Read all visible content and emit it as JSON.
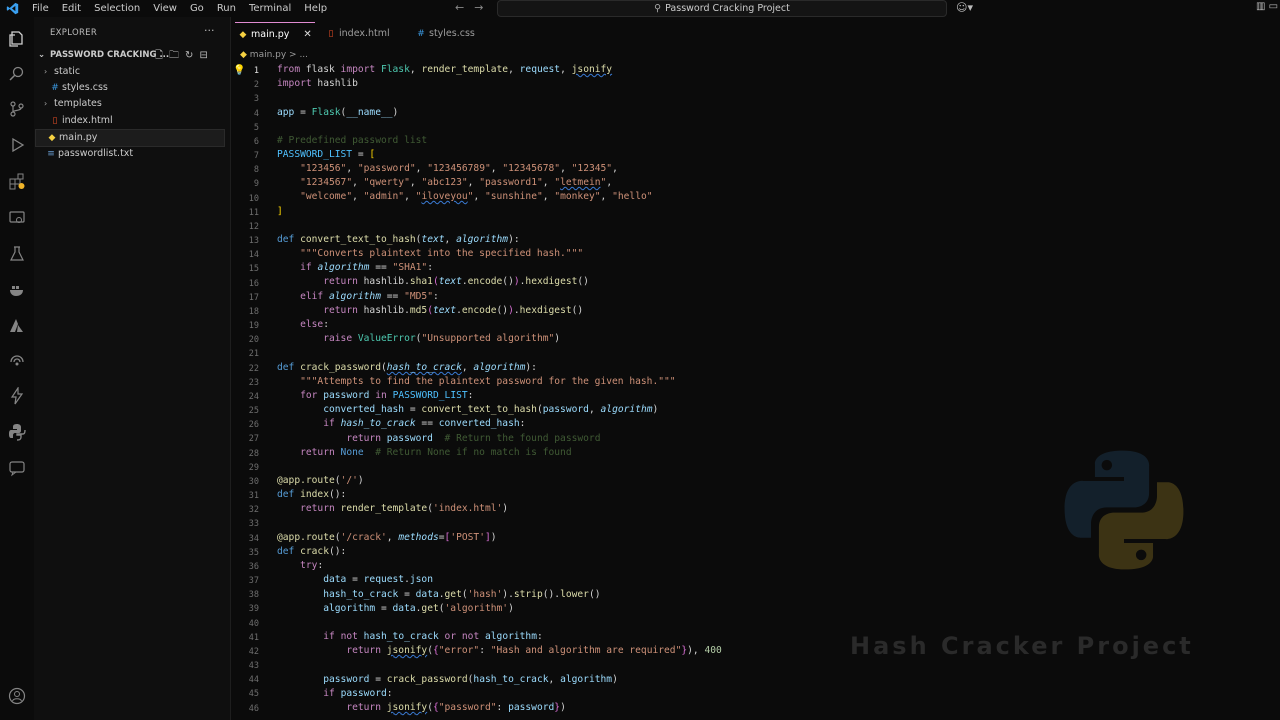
{
  "menu": [
    "File",
    "Edit",
    "Selection",
    "View",
    "Go",
    "Run",
    "Terminal",
    "Help"
  ],
  "search": {
    "text": "Password Cracking Project"
  },
  "sidebar": {
    "title": "EXPLORER",
    "folder": "PASSWORD CRACKING ...",
    "items": [
      {
        "label": "static",
        "kind": "folder"
      },
      {
        "label": "styles.css",
        "kind": "css"
      },
      {
        "label": "templates",
        "kind": "folder"
      },
      {
        "label": "index.html",
        "kind": "html"
      },
      {
        "label": "main.py",
        "kind": "python",
        "selected": true
      },
      {
        "label": "passwordlist.txt",
        "kind": "text"
      }
    ]
  },
  "tabs": [
    {
      "label": "main.py",
      "active": true
    },
    {
      "label": "index.html"
    },
    {
      "label": "styles.css"
    }
  ],
  "breadcrumb": "main.py > ...",
  "editor": {
    "line_numbers": [
      "1",
      "2",
      "3",
      "4",
      "5",
      "6",
      "7",
      "8",
      "9",
      "10",
      "11",
      "12",
      "13",
      "14",
      "15",
      "16",
      "17",
      "18",
      "19",
      "20",
      "21",
      "22",
      "23",
      "24",
      "25",
      "26",
      "27",
      "28",
      "29",
      "30",
      "31",
      "32",
      "33",
      "34",
      "35",
      "36",
      "37",
      "38",
      "39",
      "40",
      "41",
      "42",
      "43",
      "44",
      "45",
      "46"
    ],
    "current_line": 1
  },
  "watermark": {
    "text": "Hash Cracker Project"
  },
  "colors": {
    "accent_tab": "#e08bd2",
    "keyword": "#c586c0",
    "string": "#ce9178",
    "function": "#dcdcaa"
  }
}
